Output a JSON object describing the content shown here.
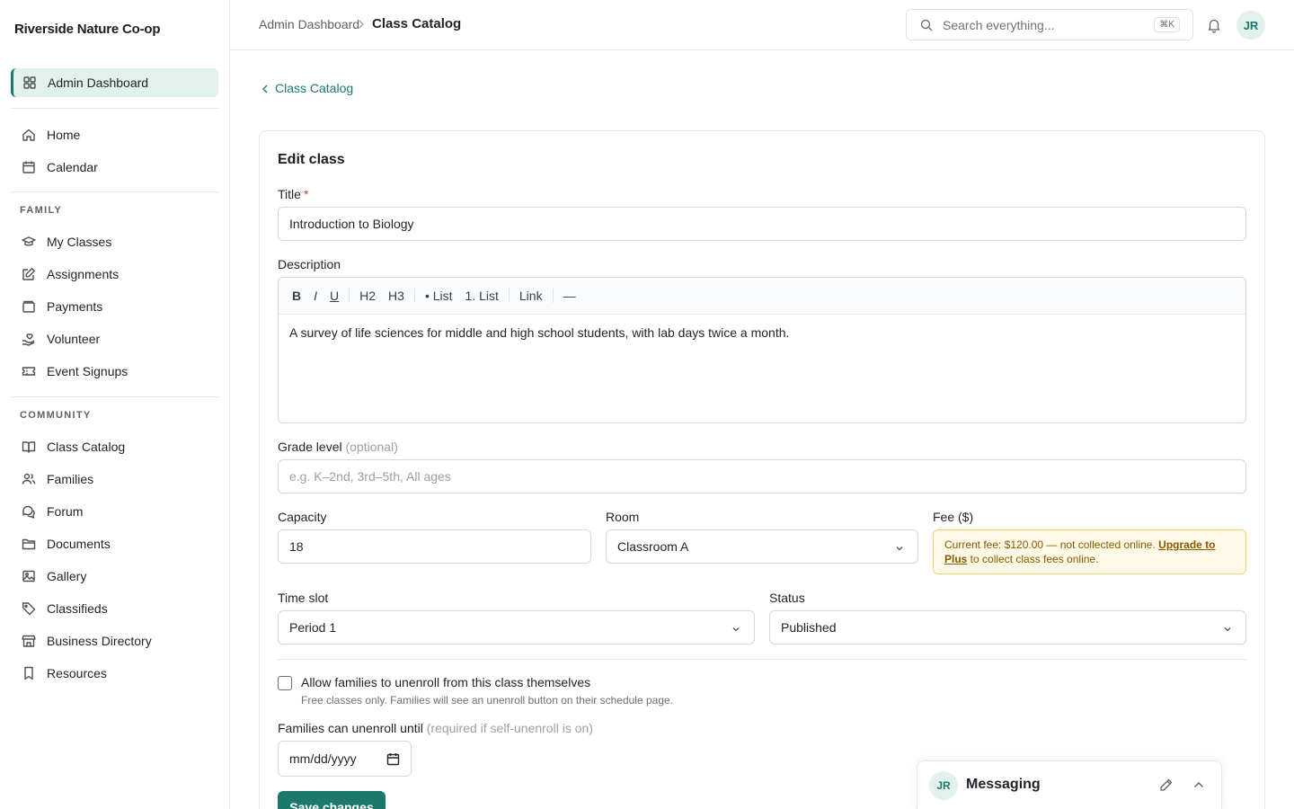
{
  "app": {
    "brand": "Riverside Nature Co-op"
  },
  "sidebar": {
    "top": [
      {
        "label": "Admin Dashboard",
        "icon": "grid-icon",
        "active": true
      }
    ],
    "main": [
      {
        "label": "Home",
        "icon": "home-icon"
      },
      {
        "label": "Calendar",
        "icon": "calendar-icon"
      }
    ],
    "family_label": "FAMILY",
    "family": [
      {
        "label": "My Classes",
        "icon": "graduation-cap-icon"
      },
      {
        "label": "Assignments",
        "icon": "pencil-square-icon"
      },
      {
        "label": "Payments",
        "icon": "wallet-icon"
      },
      {
        "label": "Volunteer",
        "icon": "hand-heart-icon"
      },
      {
        "label": "Event Signups",
        "icon": "ticket-icon"
      }
    ],
    "community_label": "COMMUNITY",
    "community": [
      {
        "label": "Class Catalog",
        "icon": "book-open-icon"
      },
      {
        "label": "Families",
        "icon": "users-icon"
      },
      {
        "label": "Forum",
        "icon": "chat-icon"
      },
      {
        "label": "Documents",
        "icon": "folder-icon"
      },
      {
        "label": "Gallery",
        "icon": "image-icon"
      },
      {
        "label": "Classifieds",
        "icon": "tag-icon"
      },
      {
        "label": "Business Directory",
        "icon": "store-icon"
      },
      {
        "label": "Resources",
        "icon": "bookmark-icon"
      }
    ]
  },
  "header": {
    "breadcrumb_root": "Admin Dashboard",
    "breadcrumb_current": "Class Catalog",
    "search_placeholder": "Search everything...",
    "search_shortcut": "⌘K",
    "user_initials": "JR"
  },
  "main": {
    "back_label": "Class Catalog",
    "form_title": "Edit class",
    "title_label": "Title",
    "title_required_mark": "*",
    "title_value": "Introduction to Biology",
    "description_label": "Description",
    "toolbar": [
      "B",
      "I",
      "U",
      "H2",
      "H3",
      "• List",
      "1. List",
      "Link",
      "—"
    ],
    "description_value": "A survey of life sciences for middle and high school students, with lab days twice a month.",
    "grade_label": "Grade level",
    "grade_optional": "(optional)",
    "grade_placeholder": "e.g. K–2nd, 3rd–5th, All ages",
    "capacity_label": "Capacity",
    "capacity_value": "18",
    "room_label": "Room",
    "room_value": "Classroom A",
    "fee_label": "Fee ($)",
    "fee_note_text": "Current fee: $120.00 — not collected online. ",
    "fee_note_link": "Upgrade to Plus",
    "fee_note_tail": " to collect class fees online.",
    "timeslot_label": "Time slot",
    "timeslot_value": "Period 1",
    "status_label": "Status",
    "status_value": "Published",
    "unenroll_checked": false,
    "unenroll_label": "Allow families to unenroll from this class themselves",
    "unenroll_help": "Free classes only. Families will see an unenroll button on their schedule page.",
    "unenroll_until_label": "Families can unenroll until",
    "unenroll_until_hint": "(required if self-unenroll is on)",
    "date_placeholder": "mm/dd/yyyy",
    "save_label": "Save changes"
  },
  "messaging": {
    "initials": "JR",
    "title": "Messaging"
  },
  "colors": {
    "accent": "#1d7a6b",
    "accent_bg": "#e3f1ec",
    "warning_bg": "#fef8e6",
    "warning_border": "#f0d27a",
    "warning_text": "#8a5a00"
  }
}
